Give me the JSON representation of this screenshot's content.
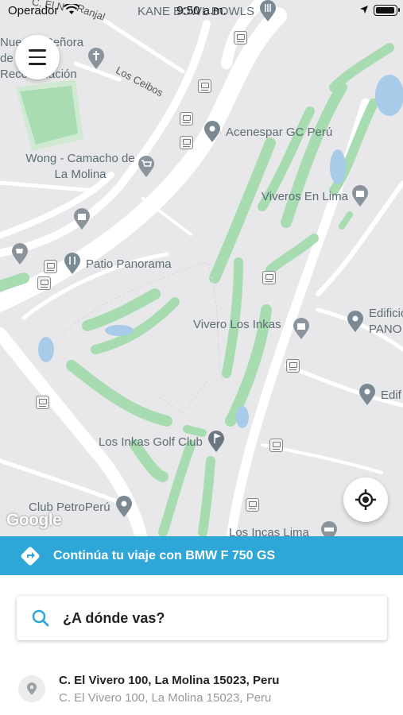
{
  "status": {
    "carrier": "Operador",
    "time": "9:50 a.m."
  },
  "map": {
    "road_labels": [
      "Los Ceibos",
      "C. El N",
      "Ranjal"
    ],
    "pois": [
      {
        "label": "KANE BOWL BOWLS",
        "icon": "restaurant-icon"
      },
      {
        "label": "Nuestra Señora de la Reconciliación",
        "icon": "church-icon"
      },
      {
        "label": "Acenespar GC Perú",
        "icon": "place-pin-icon"
      },
      {
        "label": "Wong - Camacho de La Molina",
        "icon": "shopping-cart-icon"
      },
      {
        "label": "Viveros En Lima",
        "icon": "shopping-bag-icon"
      },
      {
        "label": "Patio Panorama",
        "icon": "restaurant-icon"
      },
      {
        "label": "Vivero Los Inkas",
        "icon": "shopping-bag-icon"
      },
      {
        "label": "Edificio PANO",
        "icon": "place-pin-icon"
      },
      {
        "label": "Edif",
        "icon": "place-pin-icon"
      },
      {
        "label": "Los Inkas Golf Club",
        "icon": "golf-icon"
      },
      {
        "label": "Club PetroPerú",
        "icon": "place-pin-icon"
      },
      {
        "label": "Los Incas Lima",
        "icon": "hotel-icon"
      }
    ],
    "attribution": "Google"
  },
  "banner": {
    "text": "Continúa tu viaje con BMW F 750 GS",
    "icon": "route-diamond-icon",
    "color": "#2fa6d8"
  },
  "search": {
    "label": "¿A dónde vas?",
    "icon": "search-icon",
    "icon_color": "#2fa6d8"
  },
  "recent": {
    "title": "C. El Vivero 100, La Molina 15023, Peru",
    "subtitle": "C. El Vivero 100, La Molina 15023, Peru",
    "icon": "place-pin-icon"
  }
}
